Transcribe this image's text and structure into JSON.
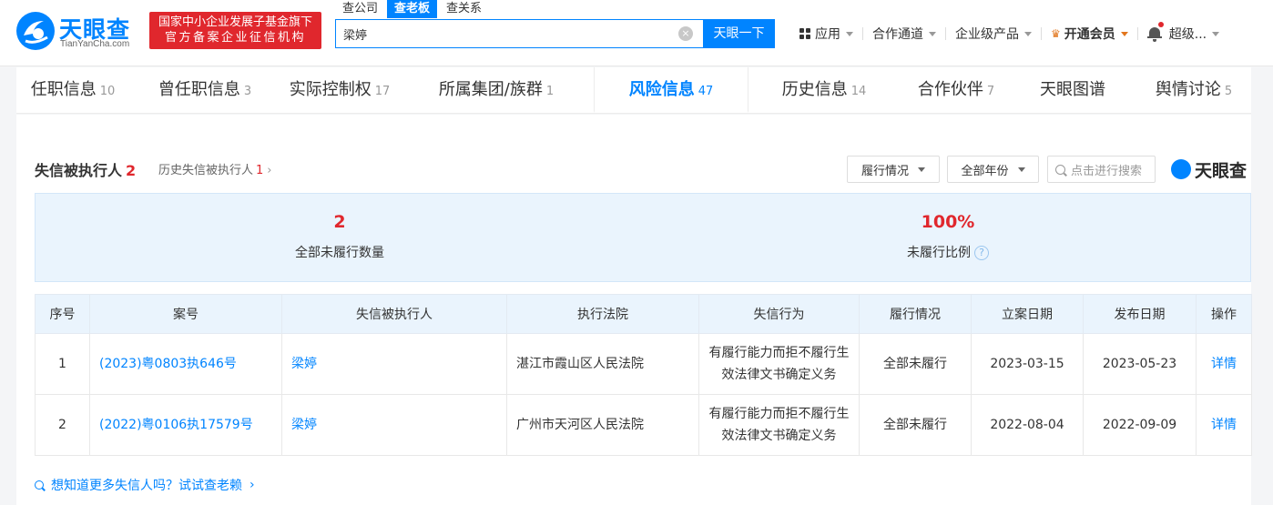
{
  "header": {
    "logo_text": "天眼查",
    "logo_sub": "TianYanCha.com",
    "badge_line1": "国家中小企业发展子基金旗下",
    "badge_line2": "官方备案企业征信机构",
    "search_tabs": [
      "查公司",
      "查老板",
      "查关系"
    ],
    "search_value": "梁婷",
    "clear_glyph": "×",
    "search_button": "天眼一下",
    "nav": {
      "apps": "应用",
      "cooperation": "合作通道",
      "enterprise": "企业级产品",
      "vip": "开通会员",
      "user": "超级..."
    }
  },
  "tabs": [
    {
      "label": "任职信息",
      "count": "10"
    },
    {
      "label": "曾任职信息",
      "count": "3"
    },
    {
      "label": "实际控制权",
      "count": "17"
    },
    {
      "label": "所属集团/族群",
      "count": "1"
    },
    {
      "label": "风险信息",
      "count": "47"
    },
    {
      "label": "历史信息",
      "count": "14"
    },
    {
      "label": "合作伙伴",
      "count": "7"
    },
    {
      "label": "天眼图谱",
      "count": ""
    },
    {
      "label": "舆情讨论",
      "count": "5"
    }
  ],
  "section": {
    "title": "失信被执行人",
    "count": "2",
    "history_label": "历史失信被执行人",
    "history_count": "1",
    "arrow": "›",
    "filter_status": "履行情况",
    "filter_year": "全部年份",
    "search_placeholder": "点击进行搜索",
    "brand": "天眼查"
  },
  "stats": {
    "unfulfilled_value": "2",
    "unfulfilled_label": "全部未履行数量",
    "ratio_value": "100%",
    "ratio_label": "未履行比例",
    "help_glyph": "?"
  },
  "table": {
    "headers": [
      "序号",
      "案号",
      "失信被执行人",
      "执行法院",
      "失信行为",
      "履行情况",
      "立案日期",
      "发布日期",
      "操作"
    ],
    "rows": [
      {
        "no": "1",
        "case": "(2023)粤0803执646号",
        "person": "梁婷",
        "court": "湛江市霞山区人民法院",
        "behavior": "有履行能力而拒不履行生效法律文书确定义务",
        "status": "全部未履行",
        "filed": "2023-03-15",
        "published": "2023-05-23",
        "action": "详情"
      },
      {
        "no": "2",
        "case": "(2022)粤0106执17579号",
        "person": "梁婷",
        "court": "广州市天河区人民法院",
        "behavior": "有履行能力而拒不履行生效法律文书确定义务",
        "status": "全部未履行",
        "filed": "2022-08-04",
        "published": "2022-09-09",
        "action": "详情"
      }
    ]
  },
  "footer_link": "想知道更多失信人吗？试试查老赖",
  "footer_arrow": "›",
  "colors": {
    "brand_blue": "#0084ff",
    "alert_red": "#e0272d",
    "vip_orange": "#e2761d"
  }
}
